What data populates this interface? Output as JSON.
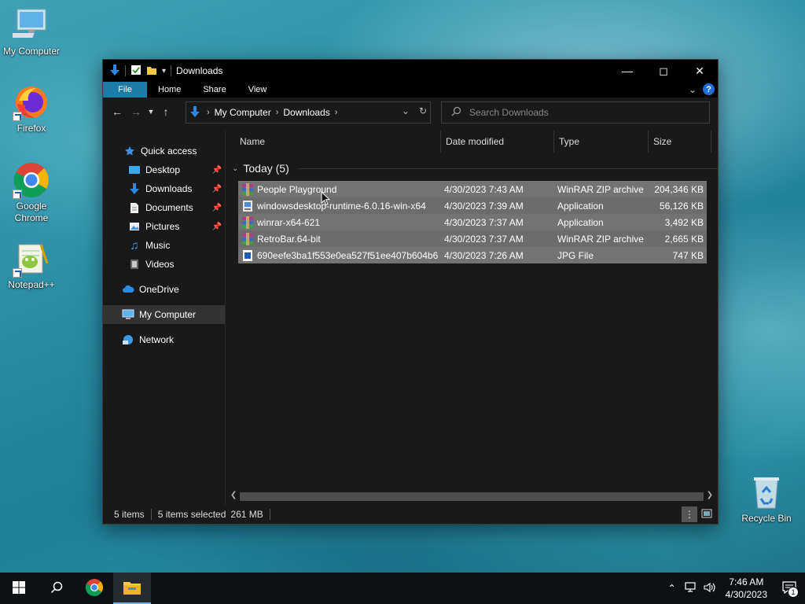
{
  "desktop": {
    "icons": [
      {
        "label": "My Computer"
      },
      {
        "label": "Firefox"
      },
      {
        "label": "Google Chrome"
      },
      {
        "label": "Notepad++"
      },
      {
        "label": "Recycle Bin"
      }
    ]
  },
  "window": {
    "title": "Downloads",
    "ribbon_tabs": [
      "File",
      "Home",
      "Share",
      "View"
    ],
    "address": {
      "crumbs": [
        "My Computer",
        "Downloads"
      ]
    },
    "search": {
      "placeholder": "Search Downloads"
    }
  },
  "nav_pane": {
    "items": [
      {
        "label": "Quick access",
        "icon": "star-icon"
      },
      {
        "label": "Desktop",
        "icon": "desktop-folder-icon",
        "pinned": true
      },
      {
        "label": "Downloads",
        "icon": "download-arrow-icon",
        "pinned": true
      },
      {
        "label": "Documents",
        "icon": "document-icon",
        "pinned": true
      },
      {
        "label": "Pictures",
        "icon": "pictures-icon",
        "pinned": true
      },
      {
        "label": "Music",
        "icon": "music-note-icon"
      },
      {
        "label": "Videos",
        "icon": "film-icon"
      },
      {
        "label": "OneDrive",
        "icon": "cloud-icon"
      },
      {
        "label": "My Computer",
        "icon": "computer-icon",
        "selected": true
      },
      {
        "label": "Network",
        "icon": "network-icon"
      }
    ]
  },
  "columns": {
    "name": "Name",
    "date": "Date modified",
    "type": "Type",
    "size": "Size"
  },
  "group": {
    "label": "Today (5)"
  },
  "files": [
    {
      "name": "People Playground",
      "date": "4/30/2023 7:43 AM",
      "type": "WinRAR ZIP archive",
      "size": "204,346 KB",
      "icon": "winrar-archive-icon"
    },
    {
      "name": "windowsdesktop-runtime-6.0.16-win-x64",
      "date": "4/30/2023 7:39 AM",
      "type": "Application",
      "size": "56,126 KB",
      "icon": "installer-icon"
    },
    {
      "name": "winrar-x64-621",
      "date": "4/30/2023 7:37 AM",
      "type": "Application",
      "size": "3,492 KB",
      "icon": "winrar-archive-icon"
    },
    {
      "name": "RetroBar.64-bit",
      "date": "4/30/2023 7:37 AM",
      "type": "WinRAR ZIP archive",
      "size": "2,665 KB",
      "icon": "winrar-archive-icon"
    },
    {
      "name": "690eefe3ba1f553e0ea527f51ee407b604b6...",
      "date": "4/30/2023 7:26 AM",
      "type": "JPG File",
      "size": "747 KB",
      "icon": "image-file-icon"
    }
  ],
  "status": {
    "count": "5 items",
    "selected": "5 items selected",
    "size": "261 MB"
  },
  "taskbar": {
    "time": "7:46 AM",
    "date": "4/30/2023",
    "notifications": "1"
  }
}
